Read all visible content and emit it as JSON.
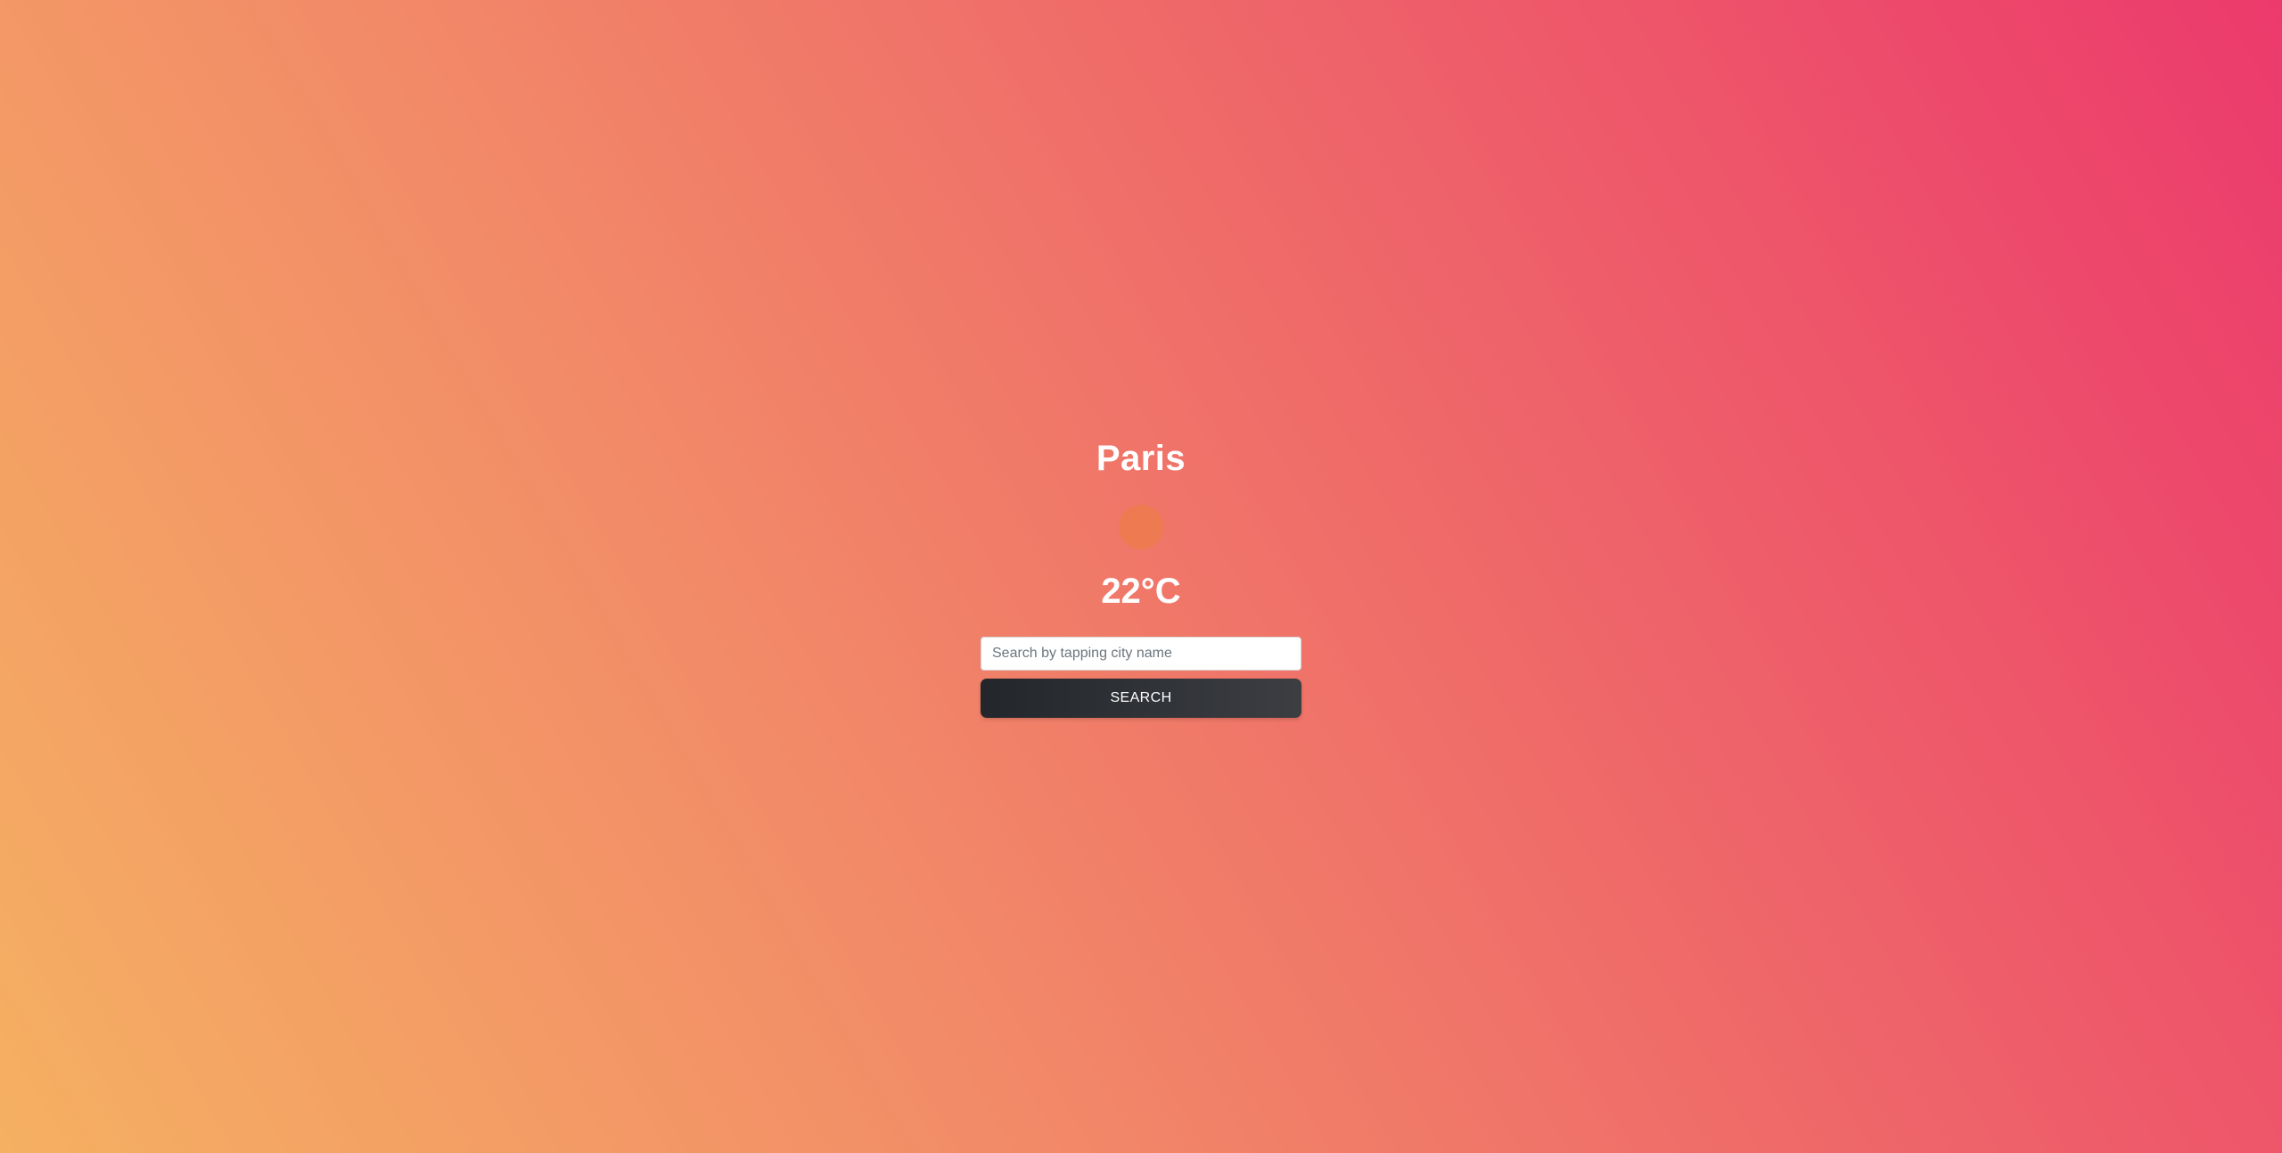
{
  "weather": {
    "city": "Paris",
    "icon": "sun-icon",
    "temperature": "22°C"
  },
  "search": {
    "placeholder": "Search by tapping city name",
    "value": "",
    "button_label": "SEARCH"
  },
  "colors": {
    "gradient_start": "#f5b062",
    "gradient_end": "#ec3a6c",
    "button_bg": "#23262b",
    "icon_color": "#ee7a52"
  }
}
